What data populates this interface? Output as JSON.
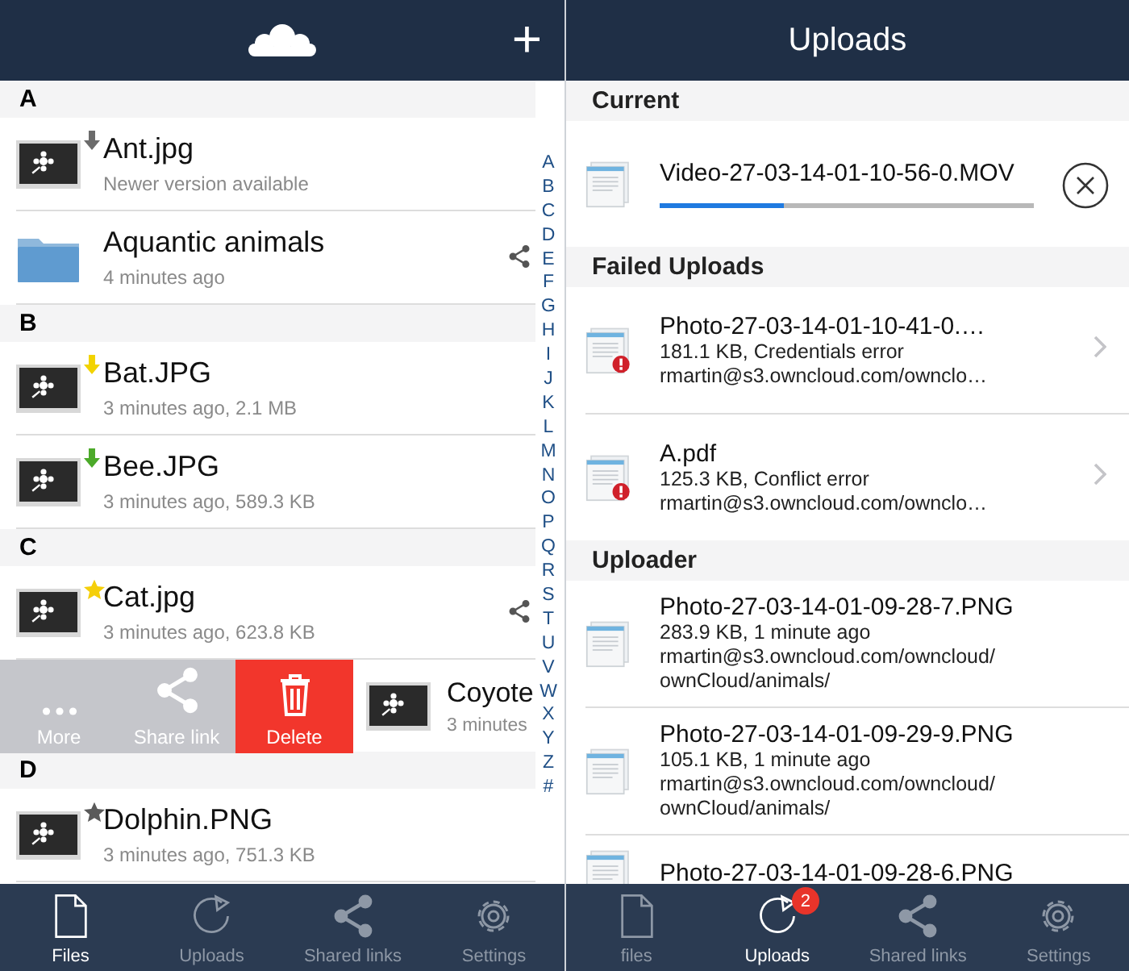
{
  "files_screen": {
    "add_button": "+",
    "sections": [
      {
        "letter": "A",
        "rows": [
          {
            "kind": "image",
            "name": "Ant.jpg",
            "subtitle": "Newer version available",
            "status": {
              "kind": "download",
              "color": "#6b6b6b"
            },
            "shared": false
          },
          {
            "kind": "folder",
            "name": "Aquantic animals",
            "subtitle": "4 minutes ago",
            "shared": true
          }
        ]
      },
      {
        "letter": "B",
        "rows": [
          {
            "kind": "image",
            "name": "Bat.JPG",
            "subtitle": "3 minutes ago, 2.1 MB",
            "status": {
              "kind": "download",
              "color": "#f2d300"
            },
            "shared": false
          },
          {
            "kind": "image",
            "name": "Bee.JPG",
            "subtitle": "3 minutes ago, 589.3 KB",
            "status": {
              "kind": "download",
              "color": "#4caa2a"
            },
            "shared": false
          }
        ]
      },
      {
        "letter": "C",
        "rows": [
          {
            "kind": "image",
            "name": "Cat.jpg",
            "subtitle": "3 minutes ago, 623.8 KB",
            "status": {
              "kind": "star",
              "color": "#f5cf0a"
            },
            "shared": true
          },
          {
            "kind": "image",
            "name": "Coyote",
            "subtitle": "3 minutes",
            "swiped": true,
            "actions": [
              {
                "kind": "more",
                "label": "More"
              },
              {
                "kind": "share",
                "label": "Share link"
              },
              {
                "kind": "delete",
                "label": "Delete"
              }
            ]
          }
        ]
      },
      {
        "letter": "D",
        "rows": [
          {
            "kind": "image",
            "name": "Dolphin.PNG",
            "subtitle": "3 minutes ago, 751.3 KB",
            "status": {
              "kind": "star",
              "color": "#5a5a5a"
            },
            "shared": false
          }
        ]
      }
    ],
    "index": [
      "A",
      "B",
      "C",
      "D",
      "E",
      "F",
      "G",
      "H",
      "I",
      "J",
      "K",
      "L",
      "M",
      "N",
      "O",
      "P",
      "Q",
      "R",
      "S",
      "T",
      "U",
      "V",
      "W",
      "X",
      "Y",
      "Z",
      "#"
    ],
    "tabs": [
      {
        "kind": "files",
        "label": "Files",
        "selected": true
      },
      {
        "kind": "uploads",
        "label": "Uploads",
        "selected": false
      },
      {
        "kind": "shared",
        "label": "Shared links",
        "selected": false
      },
      {
        "kind": "settings",
        "label": "Settings",
        "selected": false
      }
    ]
  },
  "uploads_screen": {
    "title": "Uploads",
    "sections": [
      {
        "title": "Current",
        "rows": [
          {
            "kind": "progress",
            "name": "Video-27-03-14-01-10-56-0.MOV",
            "level": 0.33
          }
        ]
      },
      {
        "title": "Failed Uploads",
        "rows": [
          {
            "kind": "failed",
            "name": "Photo-27-03-14-01-10-41-0.…",
            "lines": [
              "181.1 KB, Credentials error",
              "rmartin@s3.owncloud.com/ownclo…"
            ]
          },
          {
            "kind": "failed",
            "name": "A.pdf",
            "lines": [
              "125.3 KB, Conflict error",
              "rmartin@s3.owncloud.com/ownclo…"
            ]
          }
        ]
      },
      {
        "title": "Uploader",
        "rows": [
          {
            "kind": "done",
            "name": "Photo-27-03-14-01-09-28-7.PNG",
            "lines": [
              "283.9 KB, 1 minute ago",
              "rmartin@s3.owncloud.com/owncloud/",
              "ownCloud/animals/"
            ]
          },
          {
            "kind": "done",
            "name": "Photo-27-03-14-01-09-29-9.PNG",
            "lines": [
              "105.1 KB, 1 minute ago",
              "rmartin@s3.owncloud.com/owncloud/",
              "ownCloud/animals/"
            ]
          },
          {
            "kind": "done",
            "name": "Photo-27-03-14-01-09-28-6.PNG"
          }
        ]
      }
    ],
    "tabs": [
      {
        "kind": "files",
        "label": "files",
        "selected": false
      },
      {
        "kind": "uploads",
        "label": "Uploads",
        "selected": true,
        "badge": "2"
      },
      {
        "kind": "shared",
        "label": "Shared links",
        "selected": false
      },
      {
        "kind": "settings",
        "label": "Settings",
        "selected": false
      }
    ]
  }
}
